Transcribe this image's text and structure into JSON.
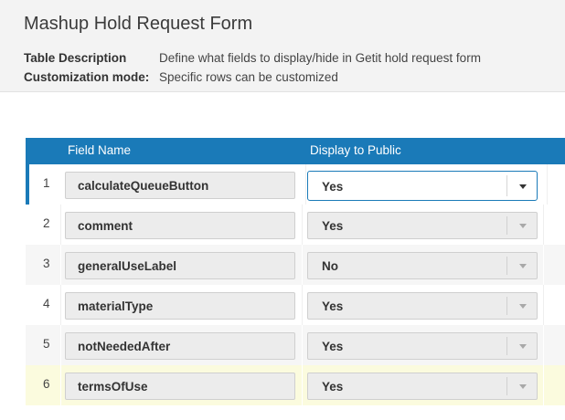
{
  "header": {
    "title": "Mashup Hold Request Form",
    "table_description_label": "Table Description",
    "table_description_value": "Define what fields to display/hide in Getit hold request form",
    "customization_mode_label": "Customization mode:",
    "customization_mode_value": "Specific rows can be customized"
  },
  "table": {
    "columns": {
      "field_name": "Field Name",
      "display_to_public": "Display to Public"
    },
    "rows": [
      {
        "num": "1",
        "field": "calculateQueueButton",
        "display": "Yes"
      },
      {
        "num": "2",
        "field": "comment",
        "display": "Yes"
      },
      {
        "num": "3",
        "field": "generalUseLabel",
        "display": "No"
      },
      {
        "num": "4",
        "field": "materialType",
        "display": "Yes"
      },
      {
        "num": "5",
        "field": "notNeededAfter",
        "display": "Yes"
      },
      {
        "num": "6",
        "field": "termsOfUse",
        "display": "Yes"
      }
    ]
  },
  "colors": {
    "header_bar": "#1a7ab8",
    "selected_row_accent": "#1a7ab8",
    "highlighted_row": "#fbfbde"
  },
  "icons": {
    "dropdown": "chevron-down-icon"
  }
}
